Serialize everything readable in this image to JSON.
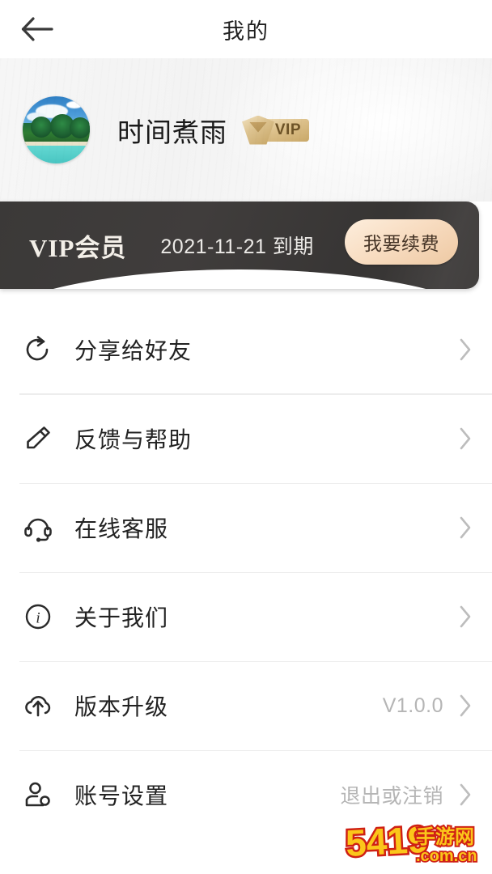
{
  "header": {
    "title": "我的",
    "back_icon": "arrow-left-icon"
  },
  "profile": {
    "username": "时间煮雨",
    "avatar_icon": "beach-avatar",
    "vip_badge_label": "VIP"
  },
  "vip_banner": {
    "title": "VIP会员",
    "expire_text": "2021-11-21 到期",
    "renew_label": "我要续费",
    "background_color": "#3b3938",
    "renew_button_color": "#f6d9ba"
  },
  "menu": {
    "items": [
      {
        "label": "分享给好友",
        "icon": "share-circle-arrow-icon",
        "value": ""
      },
      {
        "label": "反馈与帮助",
        "icon": "pencil-icon",
        "value": ""
      },
      {
        "label": "在线客服",
        "icon": "headset-icon",
        "value": ""
      },
      {
        "label": "关于我们",
        "icon": "info-circle-icon",
        "value": ""
      },
      {
        "label": "版本升级",
        "icon": "cloud-upload-icon",
        "value": "V1.0.0"
      },
      {
        "label": "账号设置",
        "icon": "user-settings-icon",
        "value": "退出或注销"
      }
    ]
  },
  "watermark": {
    "brand": "5419",
    "suffix": "手游网",
    "domain": ".com.cn",
    "color_fill": "#fbc61a",
    "color_outline": "#cf2014"
  }
}
